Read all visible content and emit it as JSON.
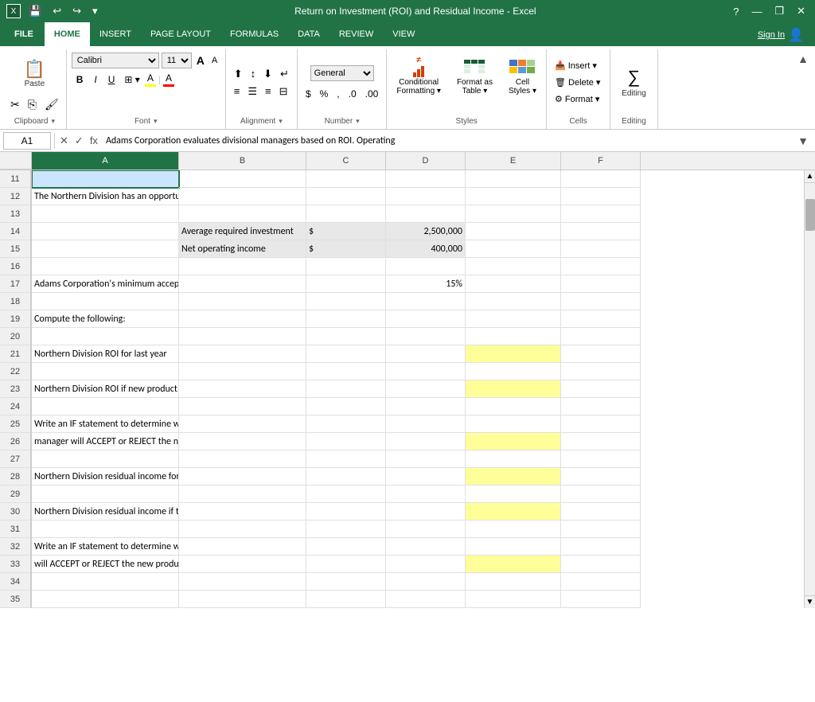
{
  "titlebar": {
    "title": "Return on Investment (ROI) and Residual Income - Excel",
    "help": "?",
    "minimize": "—",
    "restore": "❐",
    "close": "✕"
  },
  "qat": {
    "save": "💾",
    "undo": "↩",
    "redo": "↪",
    "dropdown": "▾"
  },
  "tabs": [
    "FILE",
    "HOME",
    "INSERT",
    "PAGE LAYOUT",
    "FORMULAS",
    "DATA",
    "REVIEW",
    "VIEW"
  ],
  "active_tab": "HOME",
  "signin": "Sign In",
  "ribbon": {
    "clipboard": {
      "label": "Clipboard",
      "paste_label": "Paste",
      "cut_label": "✂",
      "copy_label": "⎘",
      "format_label": "🖌"
    },
    "font": {
      "label": "Font",
      "name": "Calibri",
      "size": "11",
      "bold": "B",
      "italic": "I",
      "underline": "U",
      "size_up": "A",
      "size_down": "A",
      "highlight_color": "yellow",
      "font_color": "red"
    },
    "alignment": {
      "label": "Alignment",
      "button_label": "Alignment"
    },
    "number": {
      "label": "Number",
      "button_label": "Number",
      "percent": "%",
      "comma": ","
    },
    "styles": {
      "label": "Styles",
      "conditional_label": "Conditional\nFormatting",
      "table_label": "Format as\nTable",
      "cell_label": "Cell\nStyles"
    },
    "cells": {
      "label": "Cells",
      "insert": "Insert",
      "delete": "Delete",
      "format": "Format"
    },
    "editing": {
      "label": "Editing",
      "button_label": "Editing"
    }
  },
  "formula_bar": {
    "cell_ref": "A1",
    "formula": "Adams Corporation evaluates divisional managers based on ROI. Operating"
  },
  "columns": [
    "A",
    "B",
    "C",
    "D",
    "E",
    "F"
  ],
  "rows": [
    {
      "num": "11",
      "cells": [
        "",
        "",
        "",
        "",
        "",
        ""
      ]
    },
    {
      "num": "12",
      "cells": [
        "The Northern Division has an opportunity to add a new product line at the beginning of the year as follows:",
        "",
        "",
        "",
        "",
        ""
      ]
    },
    {
      "num": "13",
      "cells": [
        "",
        "",
        "",
        "",
        "",
        ""
      ]
    },
    {
      "num": "14",
      "cells": [
        "",
        "Average required investment",
        "$",
        "2,500,000",
        "",
        ""
      ]
    },
    {
      "num": "15",
      "cells": [
        "",
        "Net operating income",
        "$",
        "400,000",
        "",
        ""
      ]
    },
    {
      "num": "16",
      "cells": [
        "",
        "",
        "",
        "",
        "",
        ""
      ]
    },
    {
      "num": "17",
      "cells": [
        "Adams Corporation's minimum acceptable rate of return",
        "",
        "",
        "15%",
        "",
        ""
      ]
    },
    {
      "num": "18",
      "cells": [
        "",
        "",
        "",
        "",
        "",
        ""
      ]
    },
    {
      "num": "19",
      "cells": [
        "Compute the following:",
        "",
        "",
        "",
        "",
        ""
      ]
    },
    {
      "num": "20",
      "cells": [
        "",
        "",
        "",
        "",
        "",
        ""
      ]
    },
    {
      "num": "21",
      "cells": [
        "Northern Division ROI for last year",
        "",
        "",
        "",
        "YELLOW",
        ""
      ]
    },
    {
      "num": "22",
      "cells": [
        "",
        "",
        "",
        "",
        "",
        ""
      ]
    },
    {
      "num": "23",
      "cells": [
        "Northern Division ROI if new product line is added",
        "",
        "",
        "",
        "YELLOW",
        ""
      ]
    },
    {
      "num": "24",
      "cells": [
        "",
        "",
        "",
        "",
        "",
        ""
      ]
    },
    {
      "num": "25",
      "cells": [
        "Write an IF statement to determine whether the Northern Division",
        "",
        "",
        "",
        "",
        ""
      ]
    },
    {
      "num": "26",
      "cells": [
        "manager will ACCEPT or REJECT the new product line based on ROI.",
        "",
        "",
        "",
        "YELLOW",
        ""
      ]
    },
    {
      "num": "27",
      "cells": [
        "",
        "",
        "",
        "",
        "",
        ""
      ]
    },
    {
      "num": "28",
      "cells": [
        "Northern Division residual income for last year",
        "",
        "",
        "",
        "YELLOW",
        ""
      ]
    },
    {
      "num": "29",
      "cells": [
        "",
        "",
        "",
        "",
        "",
        ""
      ]
    },
    {
      "num": "30",
      "cells": [
        "Northern Division residual income if the new product line is added",
        "",
        "",
        "",
        "YELLOW",
        ""
      ]
    },
    {
      "num": "31",
      "cells": [
        "",
        "",
        "",
        "",
        "",
        ""
      ]
    },
    {
      "num": "32",
      "cells": [
        "Write an IF statement to determine whether the Northern Division manager",
        "",
        "",
        "",
        "",
        ""
      ]
    },
    {
      "num": "33",
      "cells": [
        "will ACCEPT or REJECT the new product line based on residual income",
        "",
        "",
        "",
        "YELLOW",
        ""
      ]
    },
    {
      "num": "34",
      "cells": [
        "",
        "",
        "",
        "",
        "",
        ""
      ]
    },
    {
      "num": "35",
      "cells": [
        "",
        "",
        "",
        "",
        "",
        ""
      ]
    }
  ]
}
